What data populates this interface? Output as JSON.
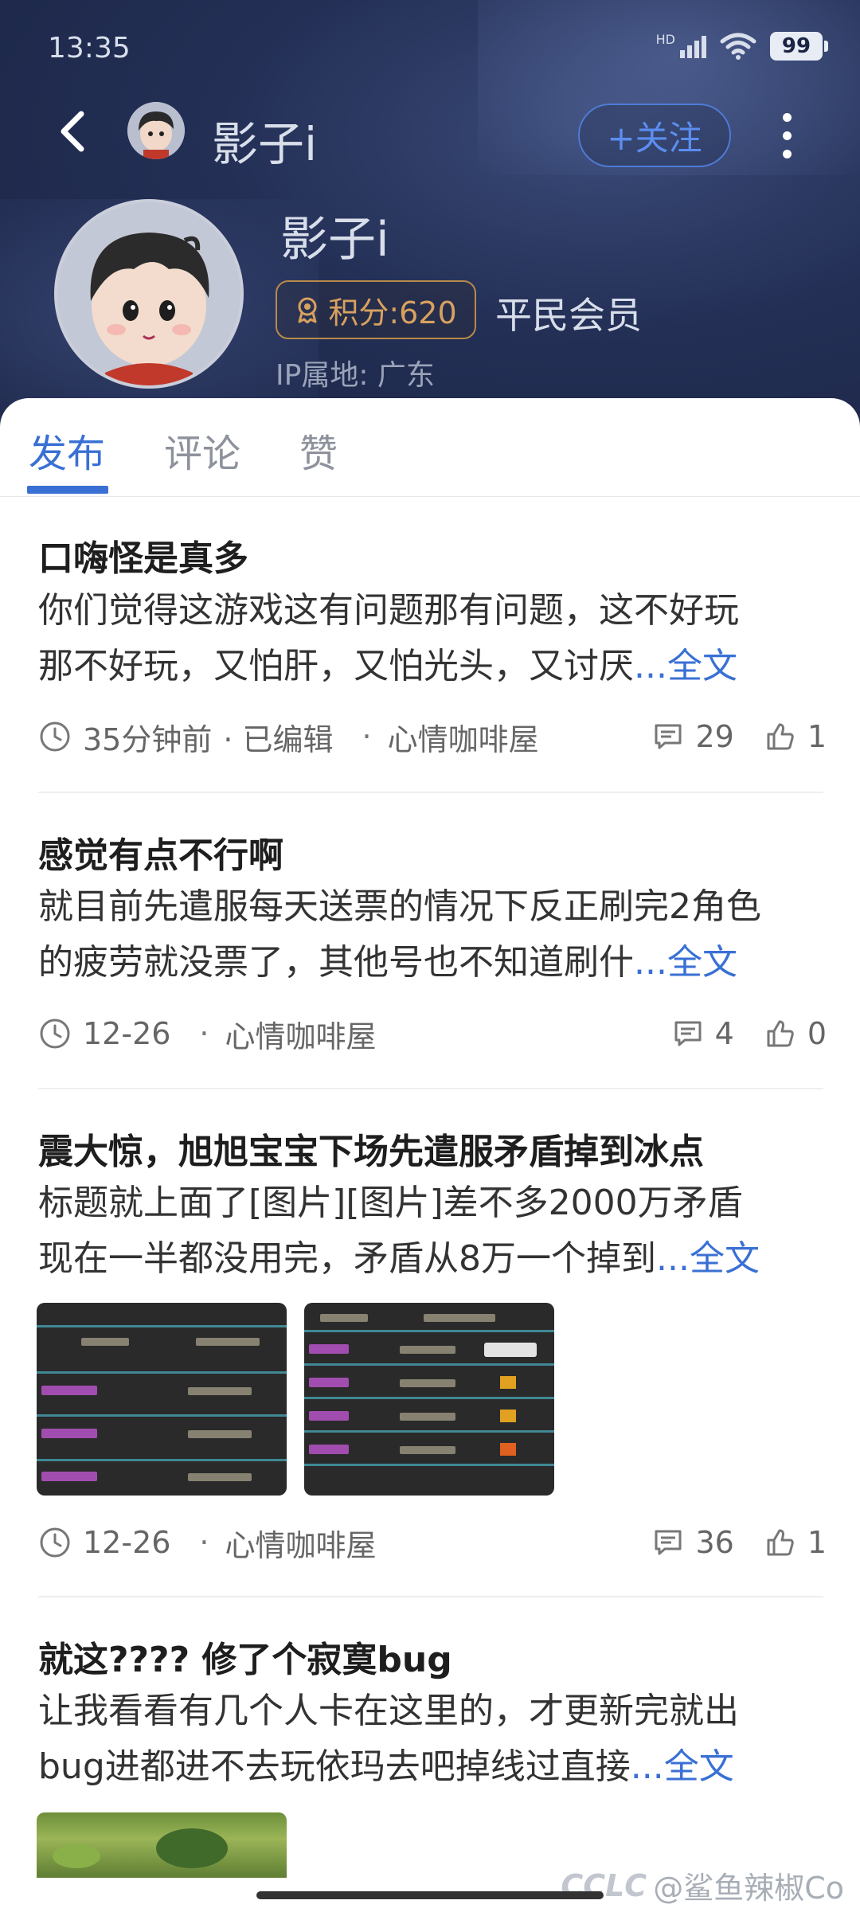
{
  "status_bar": {
    "time": "13:35",
    "network": "HD",
    "battery": "99"
  },
  "nav": {
    "title": "影子i",
    "follow_label": "+关注"
  },
  "profile": {
    "name": "影子i",
    "points": "积分:620",
    "level": "平民会员",
    "ip_location": "IP属地: 广东"
  },
  "tabs": [
    {
      "label": "发布",
      "active": true
    },
    {
      "label": "评论",
      "active": false
    },
    {
      "label": "赞",
      "active": false
    }
  ],
  "posts": [
    {
      "title": "口嗨怪是真多",
      "body_lines": [
        " 你们觉得这游戏这有问题那有问题，这不好玩",
        "那不好玩，又怕肝，又怕光头，又讨厌"
      ],
      "more": "...全文",
      "time": "35分钟前",
      "edited": "· 已编辑",
      "separator": "·",
      "forum": "心情咖啡屋",
      "comments": "29",
      "likes": "1"
    },
    {
      "title": "感觉有点不行啊",
      "body_lines": [
        "就目前先遣服每天送票的情况下反正刷完2角色",
        "的疲劳就没票了，其他号也不知道刷什"
      ],
      "more": "...全文",
      "time": "12-26",
      "separator": "·",
      "forum": "心情咖啡屋",
      "comments": "4",
      "likes": "0"
    },
    {
      "title": "震大惊，旭旭宝宝下场先遣服矛盾掉到冰点",
      "body_lines": [
        "标题就上面了[图片][图片]差不多2000万矛盾",
        "现在一半都没用完，矛盾从8万一个掉到"
      ],
      "more": "...全文",
      "time": "12-26",
      "separator": "·",
      "forum": "心情咖啡屋",
      "comments": "36",
      "likes": "1"
    },
    {
      "title": "就这???? 修了个寂寞bug",
      "body_lines": [
        " 让我看看有几个人卡在这里的，才更新完就出",
        "bug进都进不去玩依玛去吧掉线过直接"
      ],
      "more": "...全文"
    }
  ],
  "watermark": {
    "logo": "CCLC",
    "text": "@鲨鱼辣椒Co"
  },
  "colors": {
    "accent": "#3a70d4",
    "header_bg": "#232f55",
    "badge_gold": "#d8a15f"
  }
}
